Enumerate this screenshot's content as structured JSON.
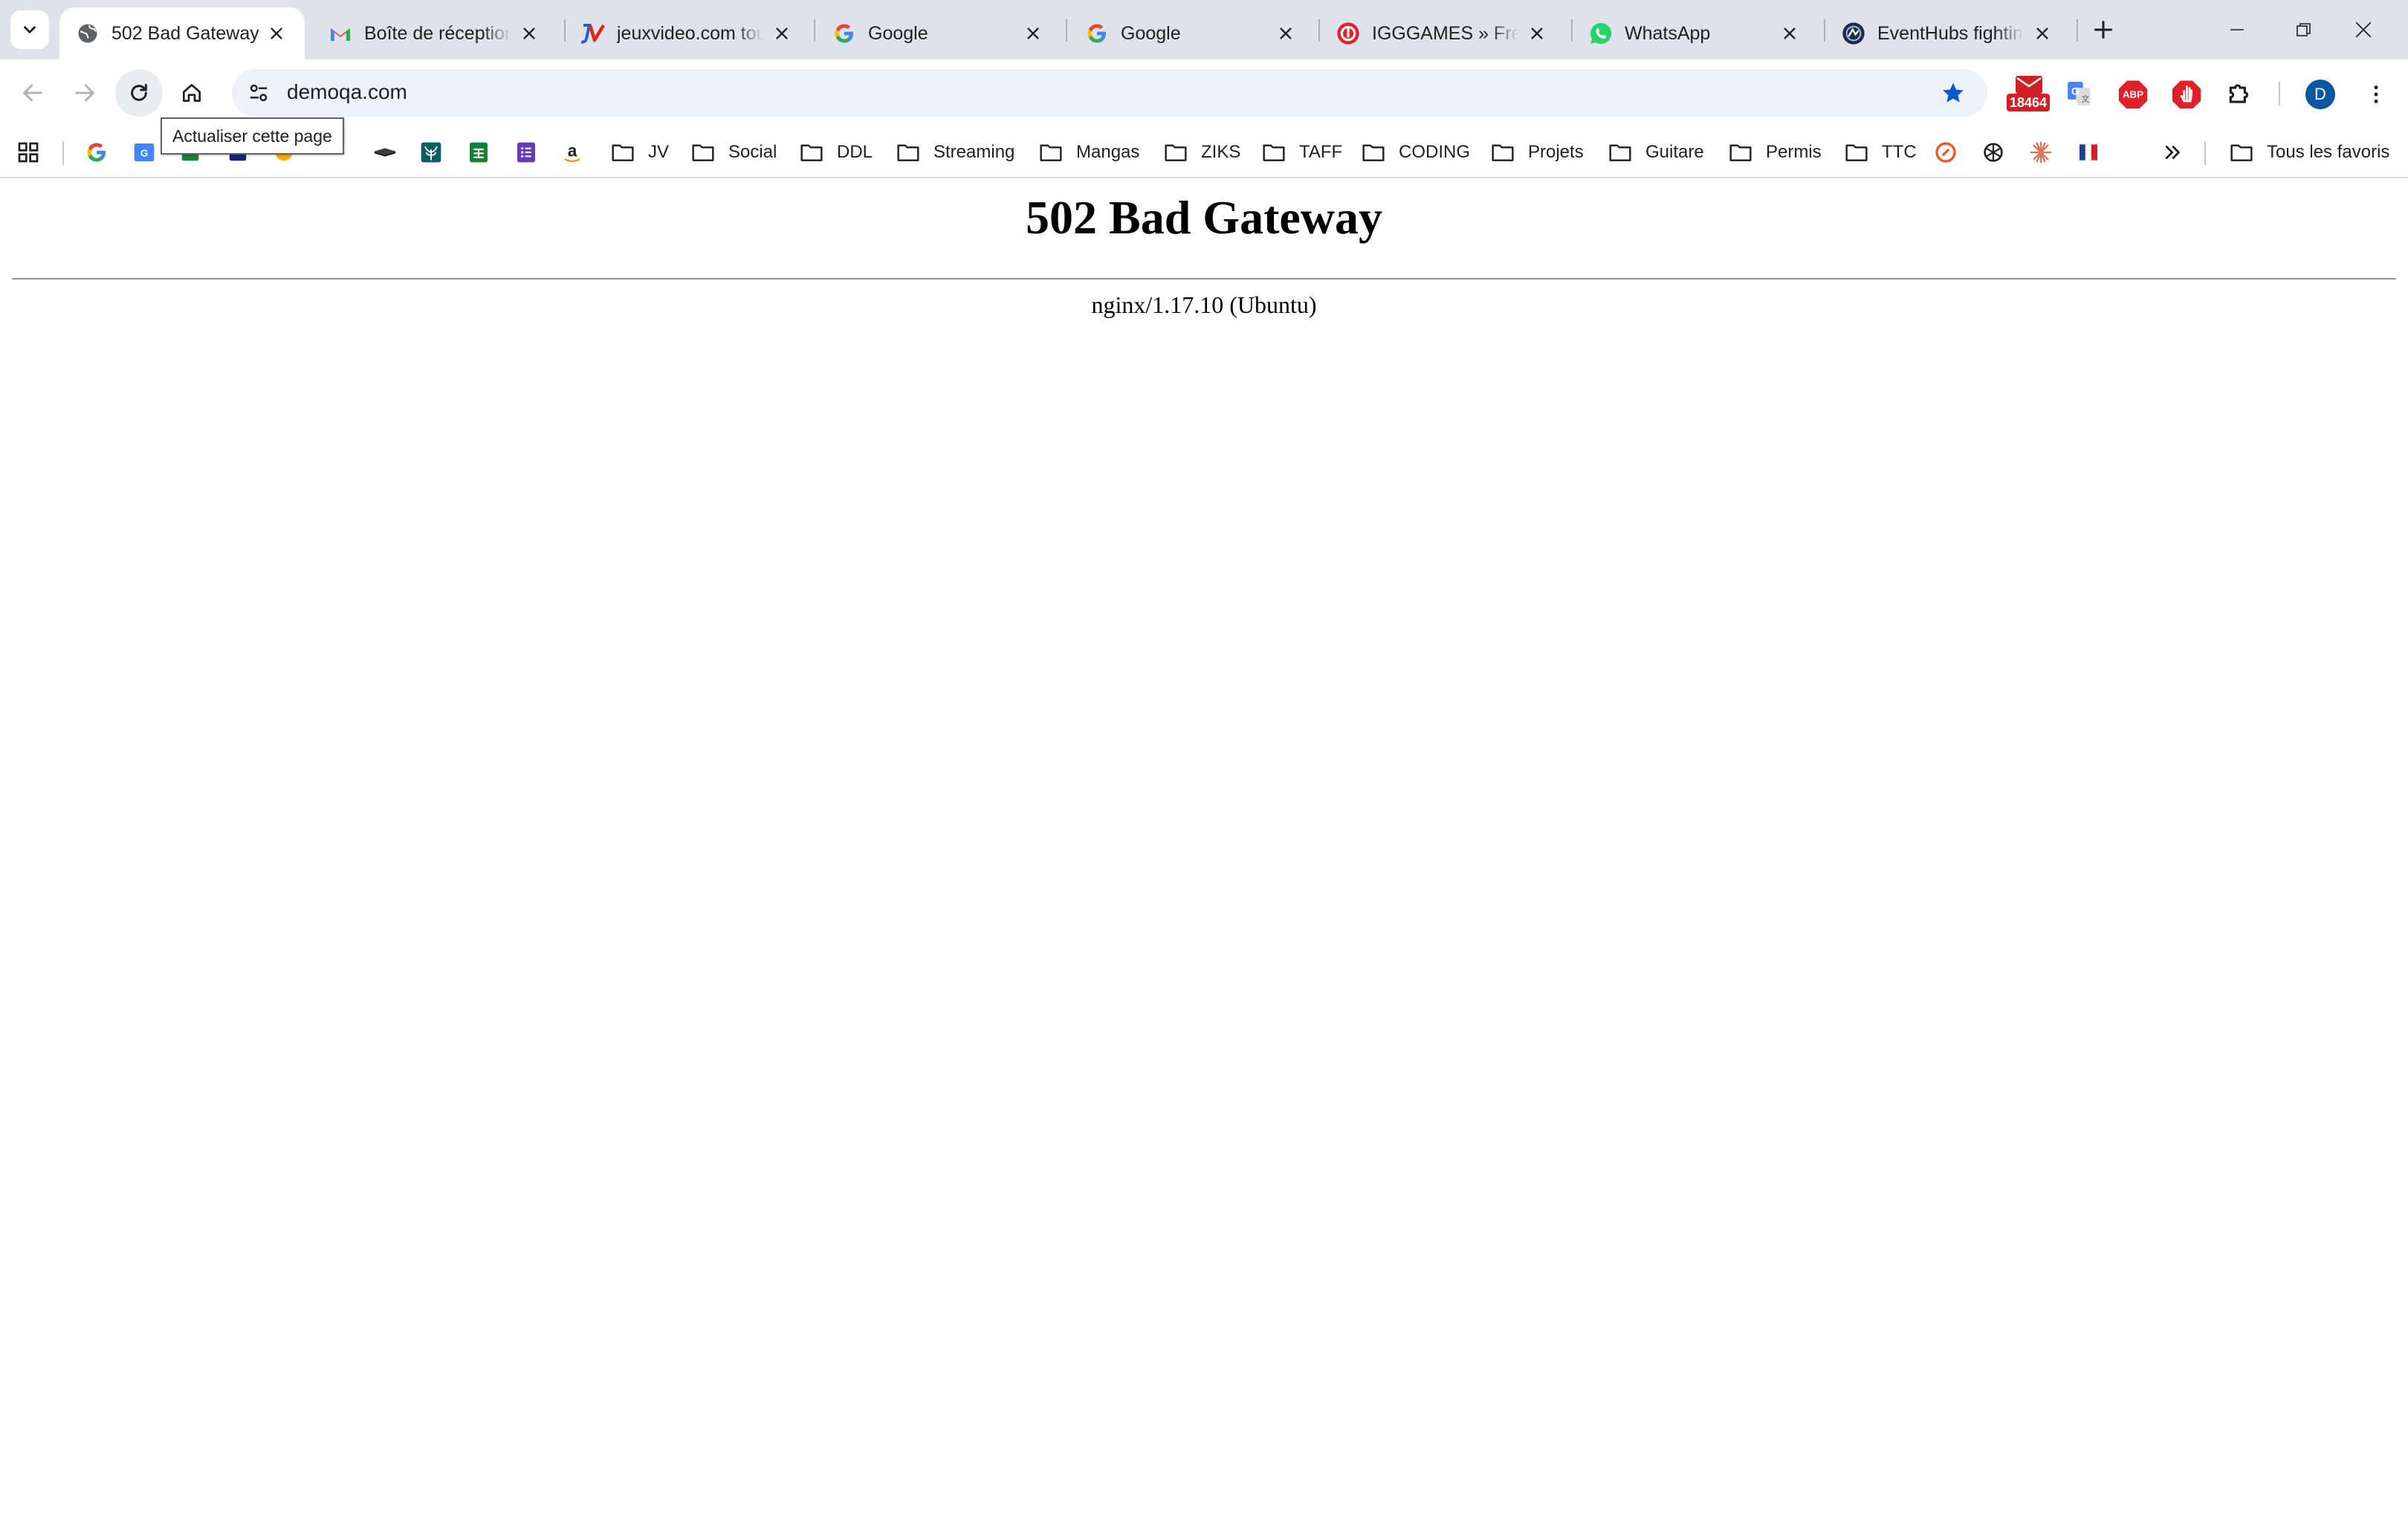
{
  "browser": {
    "tabs": [
      {
        "title": "502 Bad Gateway",
        "icon": "globe-icon",
        "active": true
      },
      {
        "title": "Boîte de réception",
        "icon": "gmail-icon",
        "active": false
      },
      {
        "title": "jeuxvideo.com tout",
        "icon": "jeuxvideo-icon",
        "active": false
      },
      {
        "title": "Google",
        "icon": "google-icon",
        "active": false
      },
      {
        "title": "Google",
        "icon": "google-icon",
        "active": false
      },
      {
        "title": "IGGGAMES » Free",
        "icon": "iggames-icon",
        "active": false
      },
      {
        "title": "WhatsApp",
        "icon": "whatsapp-icon",
        "active": false
      },
      {
        "title": "EventHubs fighting",
        "icon": "eventhubs-icon",
        "active": false
      }
    ],
    "address_bar": {
      "url": "demoqa.com"
    },
    "tooltip": "Actualiser cette page",
    "extensions": [
      {
        "name": "mail-counter-extension",
        "badge": "18464"
      },
      {
        "name": "google-translate-extension"
      },
      {
        "name": "adblock-plus-extension",
        "label": "ABP"
      },
      {
        "name": "red-stop-extension"
      },
      {
        "name": "extensions-puzzle"
      }
    ],
    "profile": {
      "initial": "D"
    },
    "bookmarks": {
      "folders": [
        "JV",
        "Social",
        "DDL",
        "Streaming",
        "Mangas",
        "ZIKS",
        "TAFF",
        "CODING",
        "Projets",
        "Guitare",
        "Permis",
        "TTC"
      ],
      "all_bookmarks_label": "Tous les favoris"
    }
  },
  "page": {
    "title": "502 Bad Gateway",
    "server": "nginx/1.17.10 (Ubuntu)"
  },
  "colors": {
    "tabstrip": "#dee3eb",
    "omnibox": "#edf2fa",
    "accent_blue": "#0b57d0",
    "avatar": "#0b57a3"
  }
}
